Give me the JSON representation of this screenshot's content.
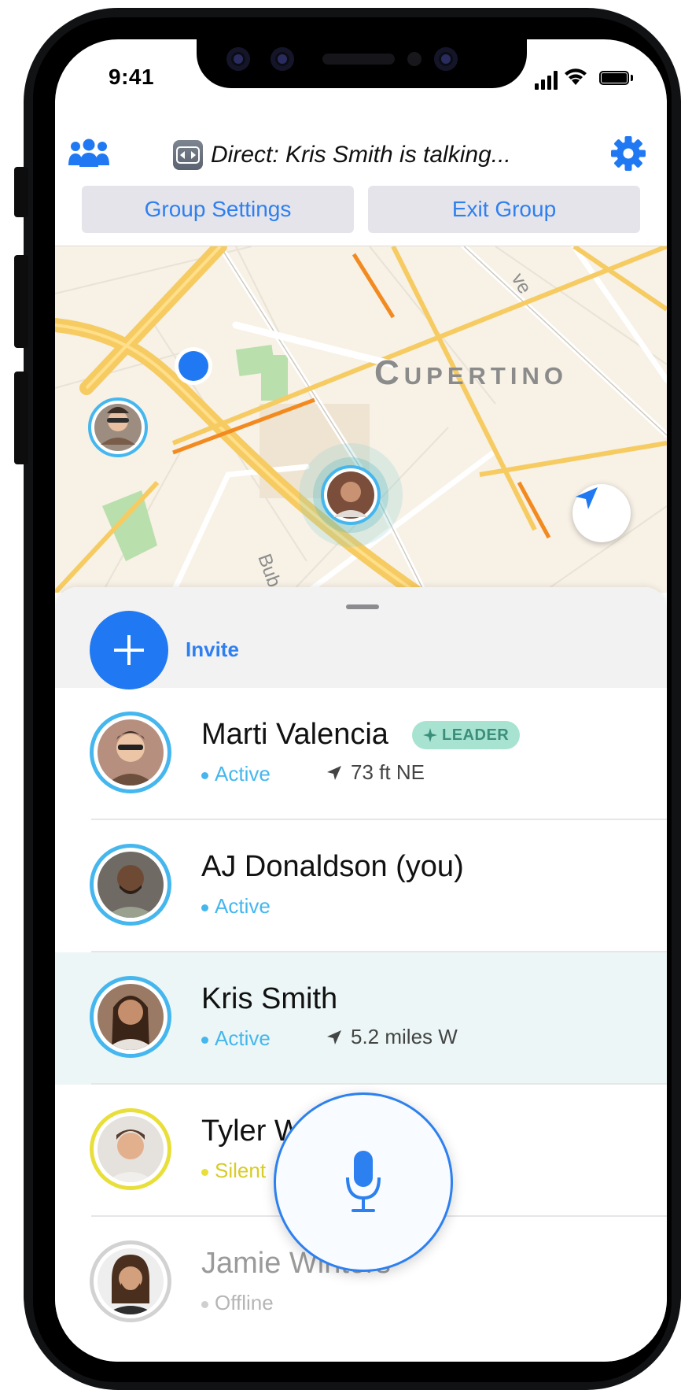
{
  "status_bar": {
    "time": "9:41"
  },
  "header": {
    "group_icon": "group-icon",
    "direct_icon": "direct-arrows-icon",
    "talking_text": "Direct: Kris Smith is talking...",
    "settings_icon": "gear-icon",
    "group_settings_label": "Group Settings",
    "exit_group_label": "Exit Group"
  },
  "map": {
    "city_label": "Cupertino",
    "street_labels": [
      "Bub",
      "ve"
    ],
    "locate_icon": "location-arrow-icon"
  },
  "sheet": {
    "invite_label": "Invite",
    "members": [
      {
        "name": "Marti Valencia",
        "badge": "LEADER",
        "status": "Active",
        "distance": "73 ft NE",
        "ring_color": "#45b7ee",
        "status_color": "#45b7ee"
      },
      {
        "name": "AJ Donaldson  (you)",
        "status": "Active",
        "ring_color": "#45b7ee",
        "status_color": "#45b7ee"
      },
      {
        "name": "Kris Smith",
        "status": "Active",
        "distance": "5.2 miles W",
        "ring_color": "#45b7ee",
        "status_color": "#45b7ee",
        "highlighted": true
      },
      {
        "name": "Tyler W",
        "status": "Silent",
        "ring_color": "#e8df3a",
        "status_color": "#d9cc27"
      },
      {
        "name": "Jamie Winters",
        "status": "Offline",
        "ring_color": "#d2d2d2",
        "status_color": "#b5b5b5"
      }
    ],
    "mic_icon": "microphone-icon"
  },
  "colors": {
    "accent": "#2079f2",
    "active": "#45b7ee",
    "silent": "#e8df3a",
    "offline": "#d2d2d2",
    "leader_bg": "#a8e3d1"
  }
}
